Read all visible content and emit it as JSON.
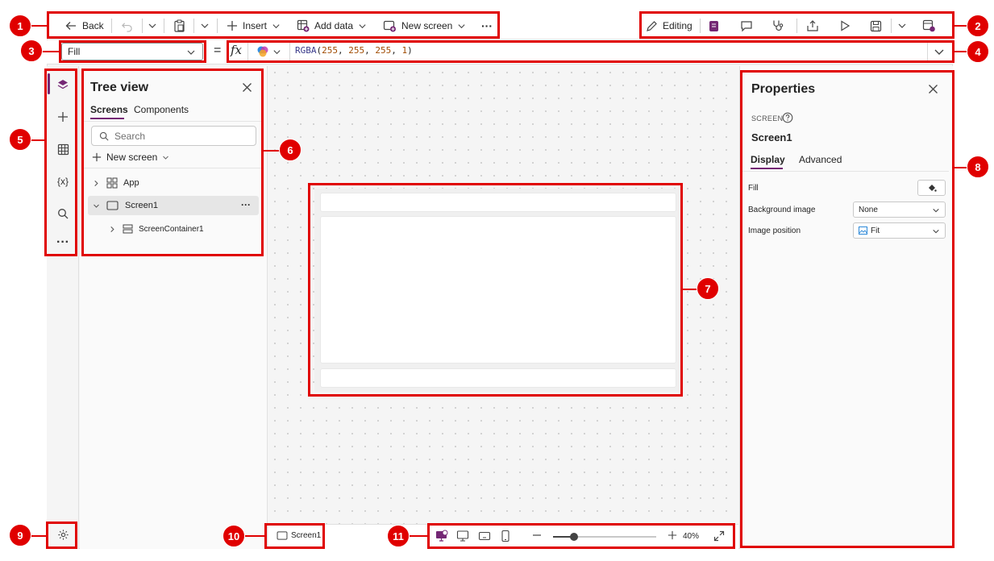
{
  "toolbar": {
    "back": "Back",
    "insert": "Insert",
    "add_data": "Add data",
    "new_screen": "New screen",
    "more": "···",
    "editing": "Editing"
  },
  "formula_bar": {
    "property": "Fill",
    "equals": "=",
    "fx": "fx",
    "fn": "RGBA",
    "args": [
      "255",
      "255",
      "255",
      "1"
    ]
  },
  "tree_view": {
    "title": "Tree view",
    "tabs": [
      "Screens",
      "Components"
    ],
    "search_placeholder": "Search",
    "new_screen": "New screen",
    "items": [
      {
        "label": "App"
      },
      {
        "label": "Screen1",
        "more": "···"
      },
      {
        "label": "ScreenContainer1"
      }
    ]
  },
  "properties": {
    "title": "Properties",
    "section": "SCREEN",
    "screen_name": "Screen1",
    "tabs": [
      "Display",
      "Advanced"
    ],
    "rows": [
      {
        "label": "Fill"
      },
      {
        "label": "Background image",
        "value": "None"
      },
      {
        "label": "Image position",
        "value": "Fit"
      }
    ]
  },
  "status_bar": {
    "screen": "Screen1",
    "zoom": "40%",
    "zoom_level": 0.4
  },
  "badges": [
    "1",
    "2",
    "3",
    "4",
    "5",
    "6",
    "7",
    "8",
    "9",
    "10",
    "11"
  ],
  "colors": {
    "accent": "#742774",
    "annotation": "#e00000"
  }
}
